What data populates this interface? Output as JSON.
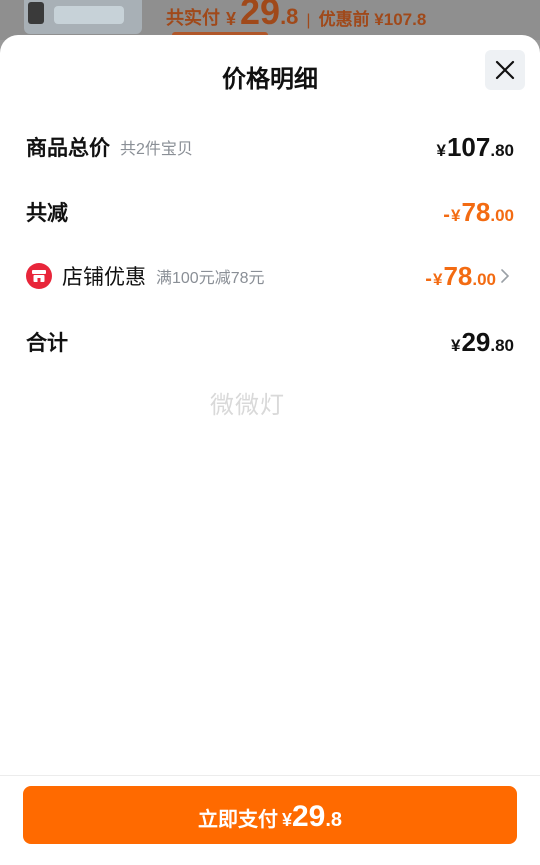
{
  "background": {
    "price_label": "共实付",
    "currency": "¥",
    "price_int": "29",
    "price_dec": ".8",
    "separator": "|",
    "orig_label": "优惠前 ¥107.8"
  },
  "sheet": {
    "title": "价格明细",
    "close_icon": "close-icon"
  },
  "rows": {
    "total": {
      "label": "商品总价",
      "sub": "共2件宝贝",
      "currency": "¥",
      "int": "107",
      "dec": ".80"
    },
    "reduce": {
      "label": "共减",
      "minus": "-",
      "currency": "¥",
      "int": "78",
      "dec": ".00"
    },
    "shop": {
      "icon": "shop-icon",
      "label": "店铺优惠",
      "sub": "满100元减78元",
      "minus": "-",
      "currency": "¥",
      "int": "78",
      "dec": ".00"
    },
    "sum": {
      "label": "合计",
      "currency": "¥",
      "int": "29",
      "dec": ".80"
    }
  },
  "watermark": "微微灯",
  "pay_button": {
    "label": "立即支付",
    "currency": "¥",
    "int": "29",
    "dec": ".8"
  },
  "colors": {
    "accent": "#ff6a00",
    "discount": "#f36b12",
    "shop_badge": "#e8263a"
  }
}
